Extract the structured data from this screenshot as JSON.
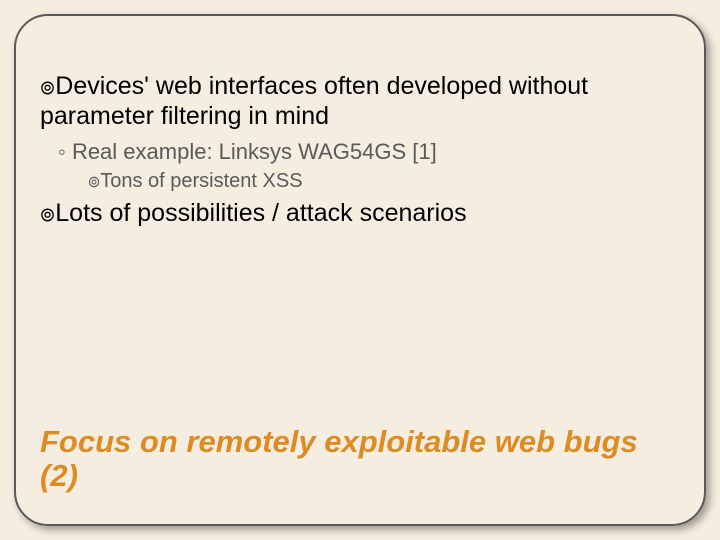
{
  "bullets": {
    "l1a": "Devices' web interfaces often developed without parameter filtering in mind",
    "l2a": "Real example: Linksys WAG54GS [1]",
    "l3a": "Tons of persistent XSS",
    "l1b": "Lots of possibilities / attack scenarios"
  },
  "title": "Focus on remotely exploitable web bugs (2)",
  "glyphs": {
    "curly": "๏",
    "ring": "◦"
  }
}
